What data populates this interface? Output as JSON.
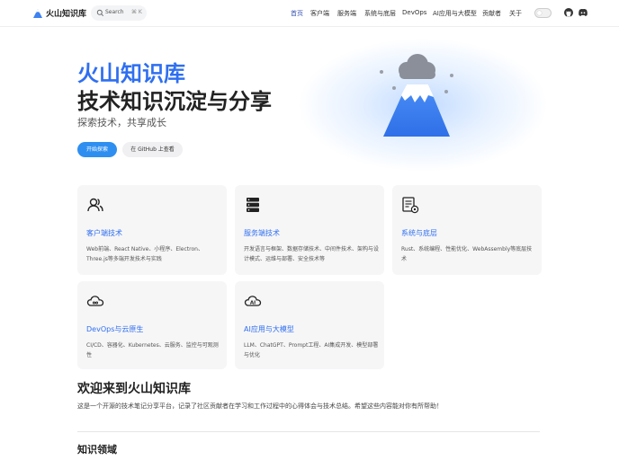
{
  "header": {
    "site_title": "火山知识库",
    "search": {
      "label": "Search",
      "shortcut": "⌘ K"
    },
    "nav": [
      "首页",
      "客户端",
      "服务端",
      "系统与底层",
      "DevOps",
      "AI应用与大模型",
      "贡献者",
      "关于"
    ],
    "active_nav": "首页",
    "accent_color": "#3451b2"
  },
  "hero": {
    "name": "火山知识库",
    "text": "技术知识沉淀与分享",
    "tagline": "探索技术，共享成长",
    "primary_action": "开始探索",
    "secondary_action": "在 GitHub 上查看",
    "name_color": "#2f6ff0"
  },
  "features": [
    {
      "icon": "users-icon",
      "title": "客户端技术",
      "desc": "Web前端、React Native、小程序、Electron、Three.js等多端开发技术与实践"
    },
    {
      "icon": "server-icon",
      "title": "服务端技术",
      "desc": "开发语言与框架、数据存储技术、中间件技术、架构与设计模式、运维与部署、安全技术等"
    },
    {
      "icon": "system-icon",
      "title": "系统与底层",
      "desc": "Rust、系统编程、性能优化、WebAssembly等底层技术"
    },
    {
      "icon": "cloud-icon",
      "title": "DevOps与云原生",
      "desc": "CI/CD、容器化、Kubernetes、云服务、监控与可观测性"
    },
    {
      "icon": "ai-icon",
      "title": "AI应用与大模型",
      "desc": "LLM、ChatGPT、Prompt工程、AI集成开发、模型部署与优化"
    }
  ],
  "welcome": {
    "title": "欢迎来到火山知识库",
    "text": "这是一个开源的技术笔记分享平台，记录了社区贡献者在学习和工作过程中的心得体会与技术总结。希望这些内容能对你有所帮助！"
  },
  "section": {
    "title": "知识领域"
  }
}
